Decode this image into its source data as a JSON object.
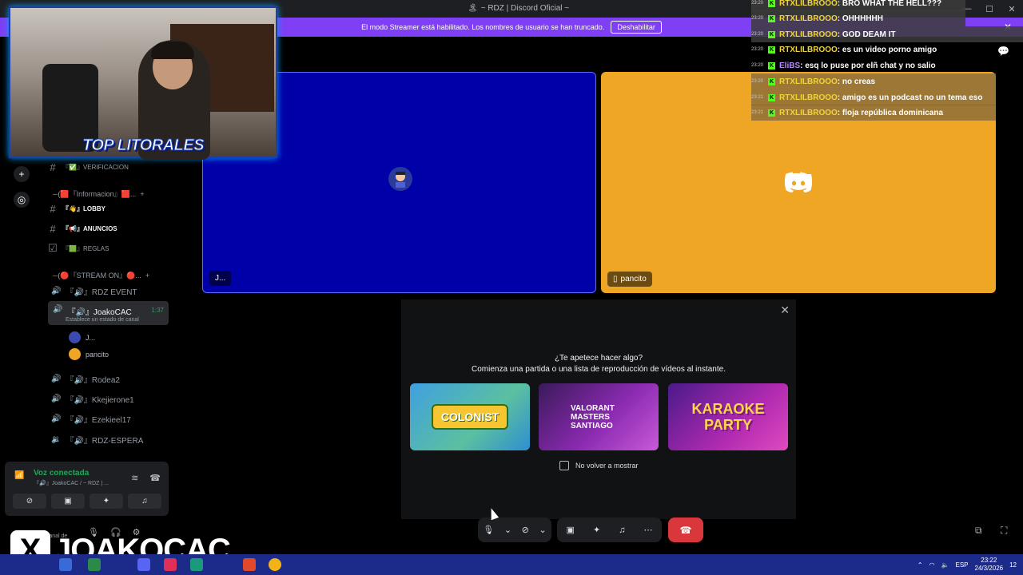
{
  "window": {
    "title": "~ RDZ | Discord Oficial ~"
  },
  "streamer_banner": {
    "text": "El modo Streamer está habilitado. Los nombres de usuario se han truncado.",
    "button": "Deshabilitar"
  },
  "channels": {
    "top_channel": "VERIFICACION",
    "category_info": "Informacion",
    "text_channels": [
      {
        "emoji": "👋",
        "label": "LOBBY"
      },
      {
        "emoji": "📢",
        "label": "ANUNCIOS"
      },
      {
        "emoji": "🟩",
        "label": "REGLAS"
      }
    ],
    "category_stream": "STREAM ON",
    "voice_channels": [
      {
        "label": "RDZ EVENT"
      },
      {
        "label": "JoakoCAC",
        "time": "1:37",
        "status": "Establece un estado de canal"
      },
      {
        "label": "Rodea2"
      },
      {
        "label": "Kkejierone1"
      },
      {
        "label": "Ezekieel17"
      },
      {
        "label": "RDZ-ESPERA"
      }
    ],
    "members": [
      {
        "name": "J..."
      },
      {
        "name": "pancito"
      }
    ]
  },
  "voice_panel": {
    "status": "Voz conectada",
    "subtitle": "『🔊』JoakoCAC / ~ RDZ | ..."
  },
  "user_panel": {
    "status": "a canal de"
  },
  "video_tiles": [
    {
      "label": "J...",
      "color": "#0000a8"
    },
    {
      "label": "pancito",
      "color": "#f0a625"
    }
  ],
  "activity": {
    "title": "¿Te apetece hacer algo?",
    "subtitle": "Comienza una partida o una lista de reproducción de vídeos al instante.",
    "cards": [
      {
        "label": "COLONIST"
      },
      {
        "label": "VALORANT MASTERS SANTIAGO"
      },
      {
        "label": "KARAOKE PARTY"
      }
    ],
    "checkbox": "No volver a mostrar"
  },
  "chat": [
    {
      "time": "23:20",
      "user": "RTXLILBROOO",
      "msg": ": BRO WHAT THE HELL???"
    },
    {
      "time": "23:20",
      "user": "RTXLILBROOO",
      "msg": ": OHHHHHH"
    },
    {
      "time": "23:20",
      "user": "RTXLILBROOO",
      "msg": ": GOD DEAM IT"
    },
    {
      "time": "23:20",
      "user": "RTXLILBROOO",
      "msg": ": es un video porno amigo"
    },
    {
      "time": "23:20",
      "user": "EliBS",
      "msg": ": esq lo puse por elñ chat y no salio"
    },
    {
      "time": "23:20",
      "user": "RTXLILBROOO",
      "msg": ": no creas"
    },
    {
      "time": "23:21",
      "user": "RTXLILBROOO",
      "msg": ": amigo es un podcast no un tema eso"
    },
    {
      "time": "23:21",
      "user": "RTXLILBROOO",
      "msg": ": floja república dominicana"
    }
  ],
  "overlay": {
    "brand": "TOP LITORALES",
    "x_logo": "X",
    "handle": "JOAKOCAC"
  },
  "taskbar": {
    "lang": "ESP",
    "time": "23:22",
    "date": "24/3/2026",
    "notif": "12"
  }
}
